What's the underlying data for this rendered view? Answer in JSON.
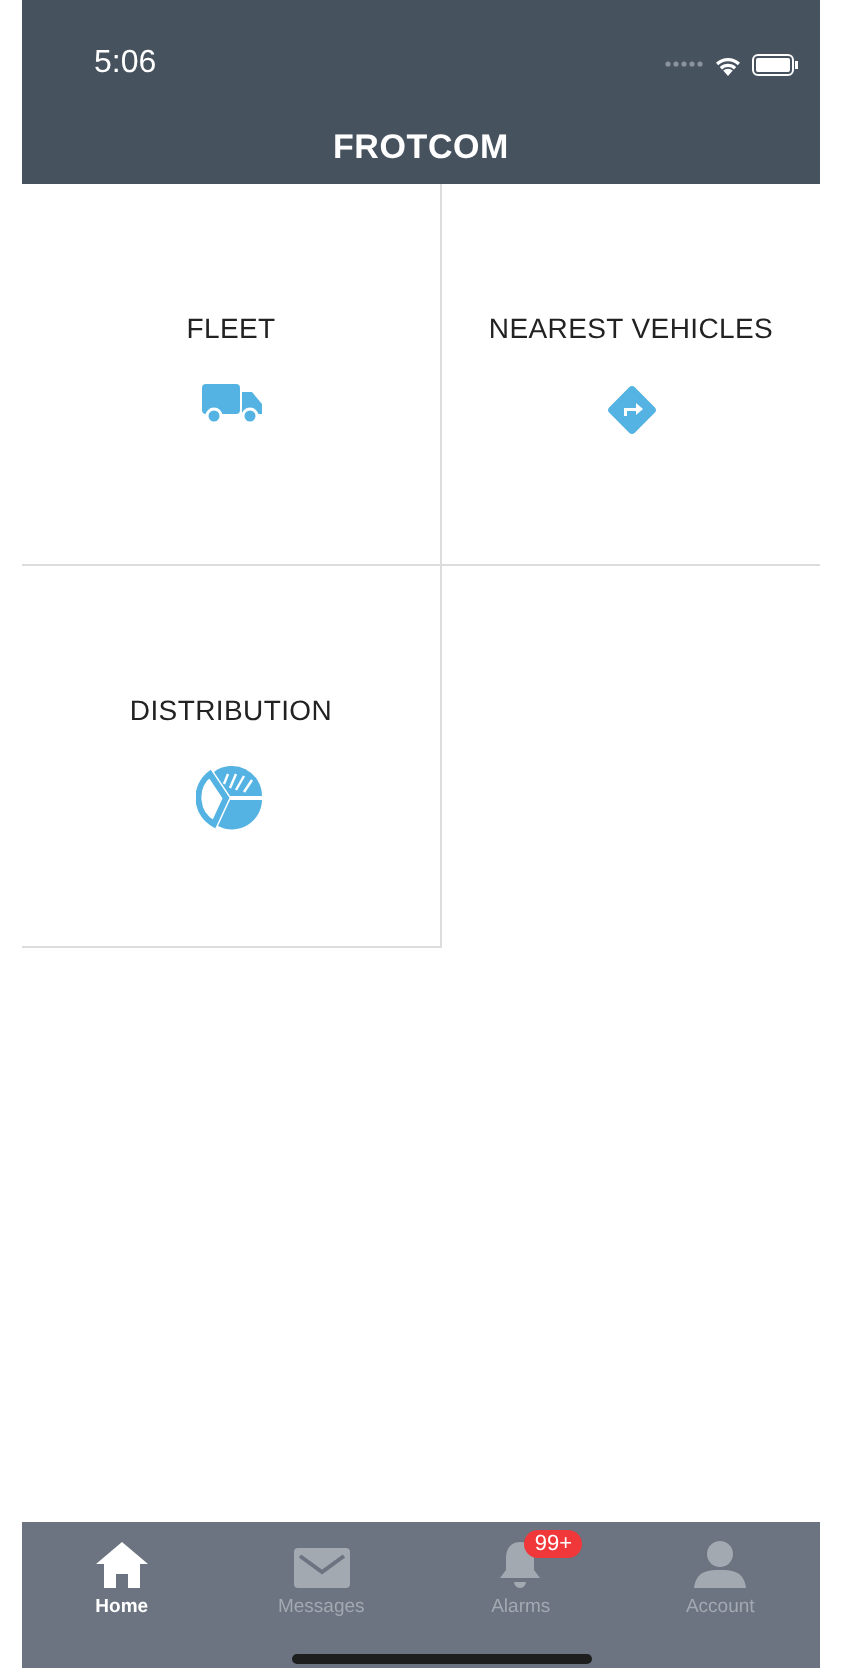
{
  "status_bar": {
    "time": "5:06"
  },
  "header": {
    "title": "FROTCOM"
  },
  "tiles": [
    {
      "label": "FLEET",
      "kind": "truck"
    },
    {
      "label": "NEAREST VEHICLES",
      "kind": "directions"
    },
    {
      "label": "DISTRIBUTION",
      "kind": "pie"
    }
  ],
  "tab_bar": [
    {
      "label": "Home",
      "kind": "home",
      "selected": true
    },
    {
      "label": "Messages",
      "kind": "mail",
      "selected": false
    },
    {
      "label": "Alarms",
      "kind": "bell",
      "selected": false,
      "badge": "99+"
    },
    {
      "label": "Account",
      "kind": "person",
      "selected": false
    }
  ]
}
